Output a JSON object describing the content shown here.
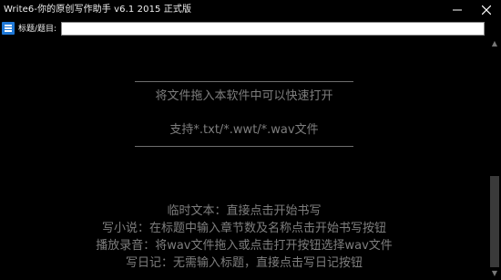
{
  "window": {
    "title": "Write6-你的原创写作助手 v6.1 2015 正式版",
    "minimize_glyph": "—",
    "close_glyph": "✕"
  },
  "toolbar": {
    "menu_icon": "hamburger-menu-icon",
    "title_label": "标题/题目:",
    "title_value": "",
    "title_placeholder": ""
  },
  "hints": {
    "drag_line": "将文件拖入本软件中可以快速打开",
    "support_line": "支持*.txt/*.wwt/*.wav文件",
    "usage": [
      "临时文本：直接点击开始书写",
      "写小说：在标题中输入章节数及名称点击开始书写按钮",
      "播放录音：将wav文件拖入或点击打开按钮选择wav文件",
      "写日记：无需输入标题，直接点击写日记按钮"
    ]
  },
  "colors": {
    "background": "#000000",
    "hint_text": "#7e7e7e",
    "accent": "#1e78d7"
  }
}
